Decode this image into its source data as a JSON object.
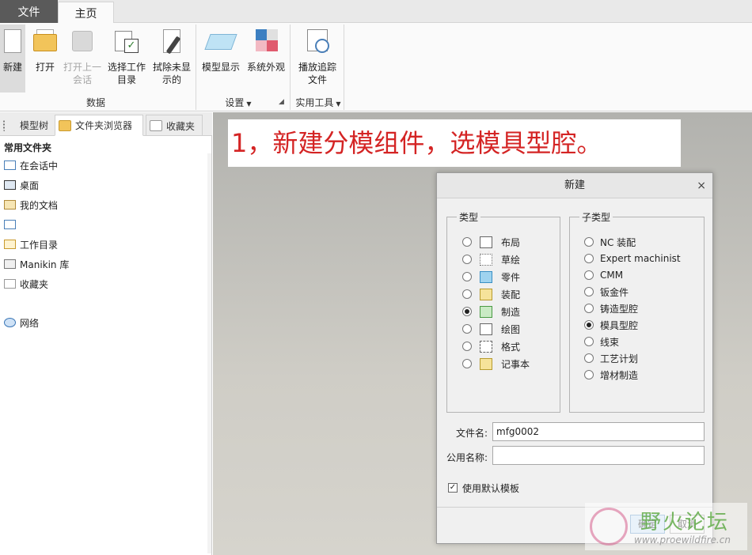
{
  "menu": {
    "file_tab": "文件",
    "home_tab": "主页"
  },
  "ribbon": {
    "buttons": {
      "new": "新建",
      "open": "打开",
      "open_last_1": "打开上一",
      "open_last_2": "会话",
      "select_dir_1": "选择工作",
      "select_dir_2": "目录",
      "erase_1": "拭除未显",
      "erase_2": "示的",
      "model_display": "模型显示",
      "system_appearance": "系统外观",
      "play_trail_1": "播放追踪",
      "play_trail_2": "文件"
    },
    "groups": {
      "data": "数据",
      "settings": "设置",
      "utilities": "实用工具"
    }
  },
  "nav": {
    "tabs": {
      "model_tree": "模型树",
      "folder_browser": "文件夹浏览器",
      "favorites": "收藏夹"
    },
    "section_title": "常用文件夹",
    "items": [
      "在会话中",
      "桌面",
      "我的文档",
      "",
      "工作目录",
      "Manikin 库",
      "收藏夹",
      "网络"
    ]
  },
  "annotation": "1，新建分模组件，选模具型腔。",
  "dialog": {
    "title": "新建",
    "close": "×",
    "type_group": "类型",
    "types": [
      {
        "label": "布局",
        "selected": false
      },
      {
        "label": "草绘",
        "selected": false
      },
      {
        "label": "零件",
        "selected": false
      },
      {
        "label": "装配",
        "selected": false
      },
      {
        "label": "制造",
        "selected": true
      },
      {
        "label": "绘图",
        "selected": false
      },
      {
        "label": "格式",
        "selected": false
      },
      {
        "label": "记事本",
        "selected": false
      }
    ],
    "subtype_group": "子类型",
    "subtypes": [
      {
        "label": "NC 装配",
        "selected": false
      },
      {
        "label": "Expert machinist",
        "selected": false
      },
      {
        "label": "CMM",
        "selected": false
      },
      {
        "label": "钣金件",
        "selected": false
      },
      {
        "label": "铸造型腔",
        "selected": false
      },
      {
        "label": "模具型腔",
        "selected": true
      },
      {
        "label": "线束",
        "selected": false
      },
      {
        "label": "工艺计划",
        "selected": false
      },
      {
        "label": "增材制造",
        "selected": false
      }
    ],
    "filename_label": "文件名:",
    "filename_value": "mfg0002",
    "common_name_label": "公用名称:",
    "common_name_value": "",
    "use_default_template": "使用默认模板",
    "use_default_template_checked": true,
    "ok": "确定",
    "cancel": "取消"
  },
  "watermark": {
    "title": "野火论坛",
    "url": "www.proewildfire.cn"
  }
}
